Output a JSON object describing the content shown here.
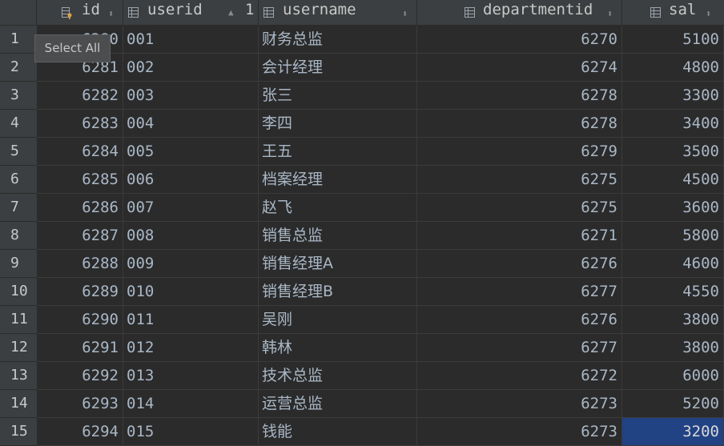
{
  "columns": [
    {
      "name": "id",
      "icon": "primary-key-column-icon",
      "sort": "⬍"
    },
    {
      "name": "userid",
      "icon": "column-icon",
      "sort": "▲",
      "sort_order": "1"
    },
    {
      "name": "username",
      "icon": "column-icon",
      "sort": "⬍"
    },
    {
      "name": "departmentid",
      "icon": "column-icon",
      "sort": "⬍"
    },
    {
      "name": "sal",
      "icon": "column-icon",
      "sort": "⬍"
    }
  ],
  "rows": [
    {
      "num": "1",
      "id": "6280",
      "userid": "001",
      "username": "财务总监",
      "departmentid": "6270",
      "sal": "5100"
    },
    {
      "num": "2",
      "id": "6281",
      "userid": "002",
      "username": "会计经理",
      "departmentid": "6274",
      "sal": "4800"
    },
    {
      "num": "3",
      "id": "6282",
      "userid": "003",
      "username": "张三",
      "departmentid": "6278",
      "sal": "3300"
    },
    {
      "num": "4",
      "id": "6283",
      "userid": "004",
      "username": "李四",
      "departmentid": "6278",
      "sal": "3400"
    },
    {
      "num": "5",
      "id": "6284",
      "userid": "005",
      "username": "王五",
      "departmentid": "6279",
      "sal": "3500"
    },
    {
      "num": "6",
      "id": "6285",
      "userid": "006",
      "username": "档案经理",
      "departmentid": "6275",
      "sal": "4500"
    },
    {
      "num": "7",
      "id": "6286",
      "userid": "007",
      "username": "赵飞",
      "departmentid": "6275",
      "sal": "3600"
    },
    {
      "num": "8",
      "id": "6287",
      "userid": "008",
      "username": "销售总监",
      "departmentid": "6271",
      "sal": "5800"
    },
    {
      "num": "9",
      "id": "6288",
      "userid": "009",
      "username": "销售经理A",
      "departmentid": "6276",
      "sal": "4600"
    },
    {
      "num": "10",
      "id": "6289",
      "userid": "010",
      "username": "销售经理B",
      "departmentid": "6277",
      "sal": "4550"
    },
    {
      "num": "11",
      "id": "6290",
      "userid": "011",
      "username": "吴刚",
      "departmentid": "6276",
      "sal": "3800"
    },
    {
      "num": "12",
      "id": "6291",
      "userid": "012",
      "username": "韩林",
      "departmentid": "6277",
      "sal": "3800"
    },
    {
      "num": "13",
      "id": "6292",
      "userid": "013",
      "username": "技术总监",
      "departmentid": "6272",
      "sal": "6000"
    },
    {
      "num": "14",
      "id": "6293",
      "userid": "014",
      "username": "运营总监",
      "departmentid": "6273",
      "sal": "5200"
    },
    {
      "num": "15",
      "id": "6294",
      "userid": "015",
      "username": "钱能",
      "departmentid": "6273",
      "sal": "3200"
    }
  ],
  "selected_cell": {
    "row": "15",
    "column": "sal"
  },
  "tooltip": "Select All",
  "colors": {
    "background": "#2b2b2b",
    "header": "#3c3f41",
    "selection": "#214283",
    "text": "#a9b7c6"
  }
}
